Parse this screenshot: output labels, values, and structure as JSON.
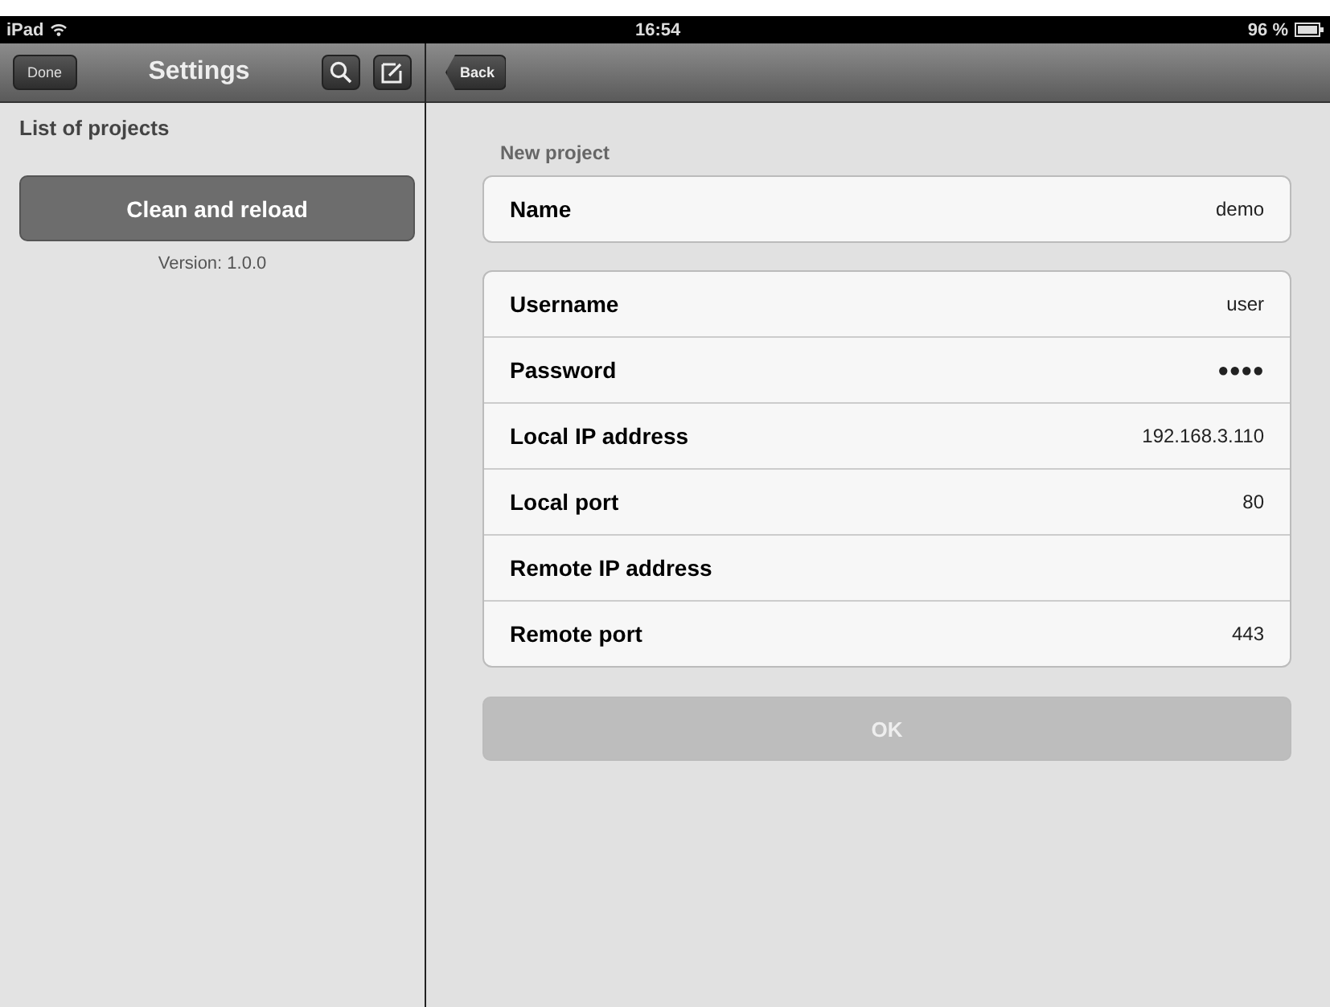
{
  "status_bar": {
    "device": "iPad",
    "time": "16:54",
    "battery": "96 %"
  },
  "master": {
    "nav": {
      "left_button": "Done",
      "title": "Settings"
    },
    "section_title": "List of projects",
    "action_button": "Clean and reload",
    "version": "Version: 1.0.0"
  },
  "detail": {
    "nav": {
      "back_button": "Back"
    },
    "section_title": "New project",
    "groups": [
      [
        {
          "label": "Name",
          "value": "demo"
        }
      ],
      [
        {
          "label": "Username",
          "value": "user"
        },
        {
          "label": "Password",
          "value": "●●●●"
        },
        {
          "label": "Local IP address",
          "value": "192.168.3.110"
        },
        {
          "label": "Local port",
          "value": "80"
        },
        {
          "label": "Remote IP address"
        },
        {
          "label": "Remote port",
          "value": "443"
        }
      ]
    ],
    "ok_button": {
      "label": "OK",
      "disabled": true
    }
  }
}
